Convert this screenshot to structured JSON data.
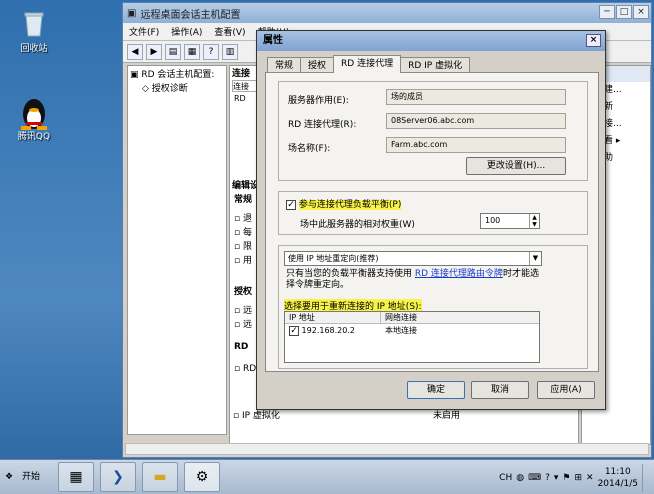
{
  "desktop": {
    "icons": [
      {
        "label": "回收站"
      },
      {
        "label": "腾讯QQ"
      }
    ]
  },
  "window": {
    "title": "远程桌面会话主机配置",
    "menu": [
      "文件(F)",
      "操作(A)",
      "查看(V)",
      "帮助(H)"
    ],
    "tree": [
      "RD 会话主机配置:",
      "授权诊断"
    ],
    "center_headers": [
      "连接",
      "连接"
    ],
    "center_rows": [
      "RD"
    ],
    "section_edit": "编辑设",
    "section_common": "常规",
    "edit_items": [
      "退",
      "每",
      "限",
      "用"
    ],
    "section_license": "授权",
    "license_items": [
      "远",
      "远"
    ],
    "rd_items": [
      "RD",
      "RD"
    ],
    "ip_row": {
      "name": "IP 虚拟化",
      "value": "未启用"
    },
    "actions": [
      "建...",
      "新",
      "接...",
      "看",
      "助"
    ]
  },
  "dialog": {
    "title": "属性",
    "close": "×",
    "tabs": [
      "常规",
      "授权",
      "RD 连接代理",
      "RD IP 虚拟化"
    ],
    "server_role_label": "服务器作用(E):",
    "server_role_value": "场的成员",
    "broker_label": "RD 连接代理(R):",
    "broker_value": "08Server06.abc.com",
    "farm_label": "场名称(F):",
    "farm_value": "Farm.abc.com",
    "change_settings": "更改设置(H)...",
    "lb_checkbox": "参与连接代理负载平衡(P)",
    "weight_label": "场中此服务器的相对权重(W)",
    "weight_value": "100",
    "redirect_option": "使用 IP 地址重定向(推荐)",
    "note_prefix": "只有当您的负载平衡器支持使用",
    "note_link": "RD 连接代理路由令牌",
    "note_suffix": "时才能选择令牌重定向。",
    "ip_select_label": "选择要用于重新连接的 IP 地址(S):",
    "ip_headers": [
      "IP 地址",
      "网络连接"
    ],
    "ip_rows": [
      {
        "ip": "192.168.20.2",
        "net": "本地连接"
      }
    ],
    "ok": "确定",
    "cancel": "取消",
    "apply": "应用(A)"
  },
  "taskbar": {
    "start": "开始",
    "lang": "CH",
    "time": "11:10",
    "date": "2014/1/5"
  }
}
